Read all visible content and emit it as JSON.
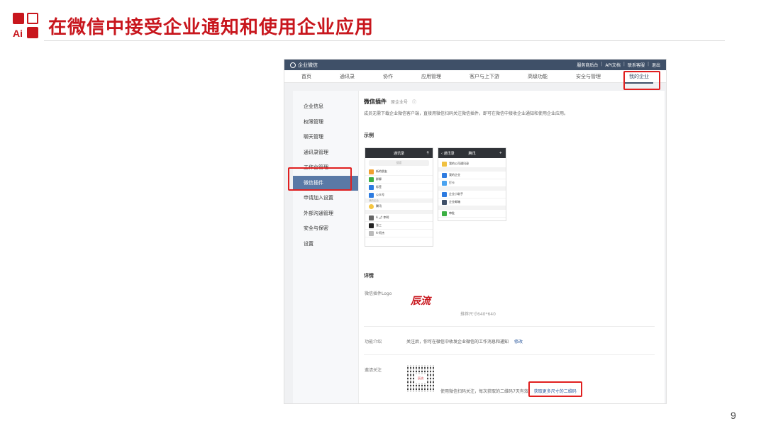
{
  "slide": {
    "logo_text": "Ai",
    "title": "在微信中接受企业通知和使用企业应用",
    "page_number": "9",
    "accent_color": "#c8161d"
  },
  "app": {
    "brand": "企业微信",
    "top_links": [
      "服务商后台",
      "API文档",
      "联系客服",
      "退出"
    ],
    "nav": [
      "首页",
      "通讯录",
      "协作",
      "应用管理",
      "客户与上下游",
      "高级功能",
      "安全与管理",
      "我的企业"
    ],
    "active_nav": "我的企业",
    "sidebar": [
      "企业信息",
      "权限管理",
      "聊天管理",
      "通讯录管理",
      "工作台管理",
      "微信插件",
      "申请加入设置",
      "外部沟通管理",
      "安全与保密",
      "设置"
    ],
    "active_sidebar": "微信插件",
    "header_color": "#3f5068"
  },
  "content": {
    "title": "微信插件",
    "subtitle": "原企业号",
    "description": "成员无需下载企业微信客户端，直接用微信扫码关注微信插件，即可在微信中接收企业通知和使用企业应用。",
    "example_label": "示例",
    "details_label": "详情",
    "logo_label": "微信插件Logo",
    "logo_hint": "推荐尺寸640*640",
    "intro_label": "功能介绍",
    "intro_text": "关注后，你可在微信中收发企业微信的工作消息和通知",
    "intro_link": "修改",
    "invite_label": "邀请关注",
    "invite_text": "使用微信扫码关注，每次获取的二维码7天有效",
    "invite_link": "获取更多尺寸的二维码"
  },
  "phone_left": {
    "header": "通讯录",
    "search": "搜索",
    "rows": [
      "新的朋友",
      "群聊",
      "标签",
      "公众号"
    ],
    "group_label": "我的企业",
    "contacts": [
      "腾讯",
      "A 🌶 李明",
      "张三",
      "A-阿杰"
    ]
  },
  "phone_right": {
    "back": "通讯录",
    "header": "腾讯",
    "rows": [
      "我的公司通讯录",
      "我的企业",
      "打卡",
      "企业小助手",
      "企业邮箱",
      "审批"
    ]
  }
}
